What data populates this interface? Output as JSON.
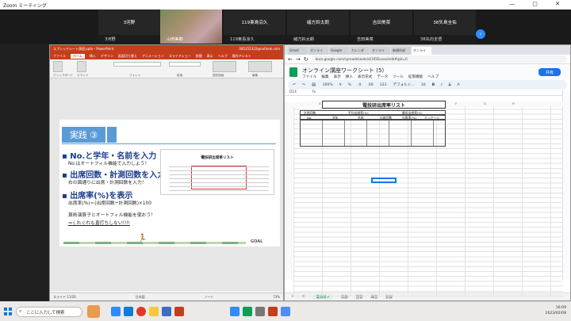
{
  "zoom": {
    "title": "Zoom ミーティング",
    "participants_top": [
      "3河野",
      "119東島涼久",
      "緒方鈴太朗",
      "吉田美菜",
      "38矢島圭佑"
    ],
    "name_tags": [
      "3河野",
      "119東島涼久",
      "緒方鈴太朗",
      "吉田美菜",
      "38矢向圭悟"
    ],
    "presenter_tag": "山田美郎"
  },
  "ppt": {
    "title": "スプレッドシート演習.pptx - PowerPoint",
    "account": "085352322@outlook.com",
    "menu": [
      "ファイル",
      "ホーム",
      "挿入",
      "デザイン",
      "画面切り替え",
      "アニメーション",
      "スライドショー",
      "校閲",
      "表示",
      "ヘルプ",
      "操作アシスト"
    ],
    "active_menu": "ホーム",
    "ribbon_groups": [
      "クリップボード",
      "スライド",
      "フォント",
      "段落",
      "図形描画",
      "編集"
    ],
    "slide_header": "実践 ③",
    "bullets": [
      {
        "head": "No.と学年・名前を入力",
        "sub": "No.はオートフィル機能で入力しよう！"
      },
      {
        "head": "出席回数・計測回数を入力",
        "sub": "右の図通りに出席・計測回数を入力！"
      },
      {
        "head": "出席率(%)を表示",
        "sub": "出席率(%)＝(出席回数÷計測回数)×100"
      }
    ],
    "extra_lines": [
      "算術演算子とオートフィル機能を使おう！",
      "⇒くれぐれも直打ちしない!!!!"
    ],
    "goal_label": "GOAL",
    "mini_table_title": "電技研出席率リスト",
    "status_left": "スライド 11/26",
    "status_mid": "日本語",
    "status_right": "ノート",
    "zoom_pct": "73%"
  },
  "chrome": {
    "tabs": [
      "Gmail",
      "オンライ",
      "Google",
      "カレンダ",
      "オンライ",
      "新規作成",
      "オンライ"
    ],
    "active_tab": 6,
    "url": "docs.google.com/spreadsheets/d/1fOExxxx/edit#gid=0",
    "sheet_title": "オンライン講座ワークシート (5)",
    "sheet_menu": [
      "ファイル",
      "編集",
      "表示",
      "挿入",
      "表示形式",
      "データ",
      "ツール",
      "拡張機能",
      "ヘルプ"
    ],
    "share_label": "共有",
    "toolbar_items": [
      "↶",
      "↷",
      "🖨",
      "100%",
      "¥",
      "%",
      ".0",
      ".00",
      "123",
      "デフォルト...",
      "10",
      "B",
      "I",
      "S",
      "A"
    ],
    "cell_ref": "D14",
    "sheet_table_title": "電技研出席率リスト",
    "col_letters": [
      "A",
      "B",
      "C",
      "D",
      "E",
      "F",
      "G",
      "H"
    ],
    "table_header_row1": [
      "計測回数",
      "平均出席率(%)",
      "最低出席率(%)"
    ],
    "table_header_row2": [
      "No.",
      "学年",
      "名前",
      "出席回数",
      "出席率(%)",
      "メッセージ"
    ],
    "bottom_tabs": [
      "電技研メ",
      "問題",
      "回答",
      "練習",
      "記録"
    ],
    "active_bottom_tab": 0
  },
  "taskbar": {
    "search_placeholder": "ここに入力して検索",
    "time": "16:09",
    "date": "2023/02/08"
  }
}
